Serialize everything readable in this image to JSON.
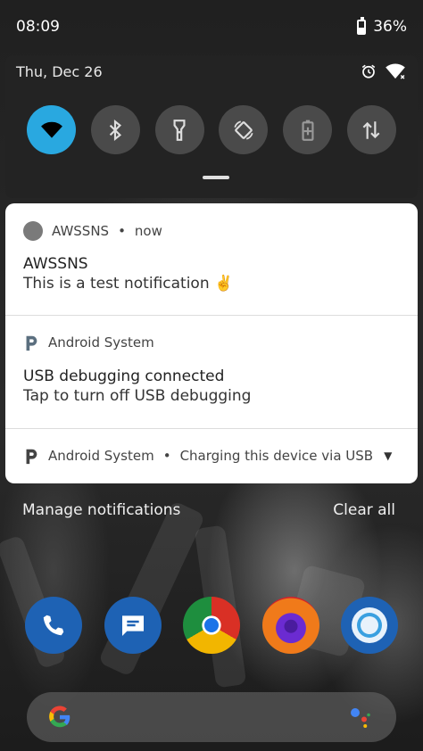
{
  "status_bar": {
    "time": "08:09",
    "battery_percent": "36%"
  },
  "quick_settings": {
    "date": "Thu, Dec 26",
    "tiles": [
      {
        "icon": "wifi-icon",
        "active": true
      },
      {
        "icon": "bluetooth-icon",
        "active": false
      },
      {
        "icon": "flashlight-icon",
        "active": false
      },
      {
        "icon": "auto-rotate-icon",
        "active": false
      },
      {
        "icon": "battery-saver-icon",
        "active": false
      },
      {
        "icon": "mobile-data-icon",
        "active": false
      }
    ]
  },
  "notifications": [
    {
      "app": "AWSSNS",
      "time": "now",
      "title": "AWSSNS",
      "text": "This is a test notification ✌️"
    },
    {
      "app": "Android System",
      "title": "USB debugging connected",
      "text": "Tap to turn off USB debugging"
    },
    {
      "app": "Android System",
      "summary": "Charging this device via USB"
    }
  ],
  "actions": {
    "manage": "Manage notifications",
    "clear": "Clear all"
  },
  "dock": {
    "apps": [
      "phone-icon",
      "messages-icon",
      "chrome-icon",
      "firefox-icon",
      "camera-icon"
    ]
  },
  "search": {
    "logo": "google-logo-icon",
    "assistant": "google-assistant-icon"
  },
  "colors": {
    "accent": "#29a8e0",
    "tile_inactive": "#4a4a4a",
    "panel": "#232323"
  }
}
